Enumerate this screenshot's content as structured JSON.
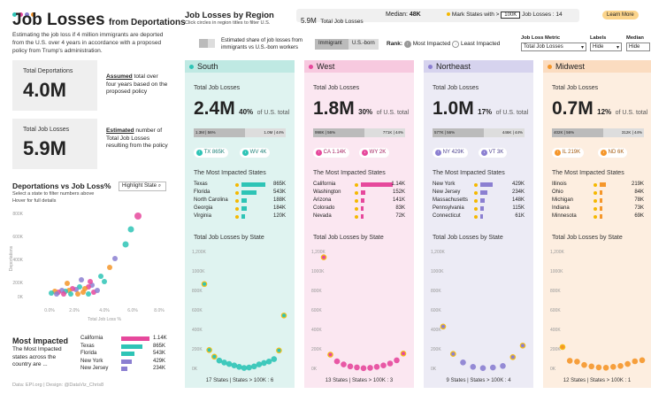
{
  "title": {
    "main": "Job Losses",
    "sub": "from Deportations"
  },
  "intro": "Estimating the job loss if 4 million immigrants are deported from the U.S. over 4 years in accordance with a proposed policy from Trump's administration.",
  "stats": [
    {
      "label": "Total Deportations",
      "value": "4.0M",
      "desc_bold": "Assumed",
      "desc": " total over four years based on the proposed policy"
    },
    {
      "label": "Total Job Losses",
      "value": "5.9M",
      "desc_bold": "Estimated",
      "desc": " number of Total Job Losses resulting from the policy"
    }
  ],
  "scatter": {
    "title": "Deportations vs Job Loss%",
    "button": "Highlight State",
    "note1": "Select a state to filter numbers above",
    "note2": "Hover for full details",
    "ylabel": "Deportations",
    "xlabel": "Total Job Loss %",
    "yticks": [
      "800K",
      "600K",
      "400K",
      "200K",
      "0K"
    ],
    "xticks": [
      "0.0%",
      "2.0%",
      "4.0%",
      "6.0%",
      "8.0%"
    ]
  },
  "most_impacted": {
    "title": "Most Impacted",
    "desc": "The Most Impacted states across the country are ...",
    "rows": [
      {
        "state": "California",
        "value": "1.14K",
        "color": "#e6489c",
        "frac": 1.0
      },
      {
        "state": "Texas",
        "value": "865K",
        "color": "#2ec4b6",
        "frac": 0.76
      },
      {
        "state": "Florida",
        "value": "543K",
        "color": "#2ec4b6",
        "frac": 0.48
      },
      {
        "state": "New York",
        "value": "429K",
        "color": "#8b7fd1",
        "frac": 0.38
      },
      {
        "state": "New Jersey",
        "value": "234K",
        "color": "#8b7fd1",
        "frac": 0.21
      }
    ]
  },
  "credits": "Data: EPI.org | Design: @DataViz_Chris8",
  "header": {
    "title": "Job Losses by Region",
    "subtitle": "Click circles in region titles to filter U.S.",
    "total": "5.9M",
    "total_label": "Total Job Losses",
    "median_label": "Median:",
    "median": "48K",
    "mark_label": "Mark States with >",
    "mark_value": "100K",
    "mark_suffix": "Job Losses :",
    "mark_count": "14",
    "learn": "Learn More"
  },
  "controls": {
    "share_note": "Estimated share of job losses from immigrants vs U.S.-born workers",
    "immigrant": "Immigrant",
    "usborn": "U.S.-born",
    "rank": "Rank:",
    "most": "Most Impacted",
    "least": "Least Impacted",
    "metric_label": "Job Loss Metric",
    "metric_value": "Total Job Losses",
    "labels_label": "Labels",
    "labels_value": "Hide",
    "median_label": "Median",
    "median_value": "Hide"
  },
  "section_labels": {
    "total": "Total Job Losses",
    "states": "The Most Impacted States",
    "by_state": "Total Job Losses by State"
  },
  "yaxis": [
    "1,200K",
    "1000K",
    "800K",
    "600K",
    "400K",
    "200K",
    "0K"
  ],
  "colors": {
    "south": "#2ec4b6",
    "west": "#e6489c",
    "northeast": "#8b7fd1",
    "midwest": "#f5962a",
    "marker": "#f5b800"
  },
  "regions": [
    {
      "name": "South",
      "bg": "#dff3f0",
      "head": "#bfe9e3",
      "accent": "#2ec4b6",
      "ltext": "#1a7f76",
      "total": "2.4M",
      "pct": "40%",
      "pct_label": "of U.S. total",
      "split_left": "1.3M | 56%",
      "split_right": "1.0M | 44%",
      "split_frac": 0.56,
      "top": "TX 865K",
      "bottom": "WV 4K",
      "states": [
        {
          "name": "Texas",
          "value": "865K",
          "frac": 0.76
        },
        {
          "name": "Florida",
          "value": "543K",
          "frac": 0.48
        },
        {
          "name": "North Carolina",
          "value": "188K",
          "frac": 0.16
        },
        {
          "name": "Georgia",
          "value": "184K",
          "frac": 0.16
        },
        {
          "name": "Virginia",
          "value": "120K",
          "frac": 0.1
        }
      ],
      "points": [
        865,
        543,
        188,
        184,
        120,
        95,
        80,
        70,
        60,
        55,
        45,
        40,
        30,
        20,
        15,
        8,
        4
      ],
      "footer": "17 States | States > 100K : 6"
    },
    {
      "name": "West",
      "bg": "#fbe7f1",
      "head": "#f7c9df",
      "accent": "#e6489c",
      "ltext": "#a3205f",
      "total": "1.8M",
      "pct": "30%",
      "pct_label": "of U.S. total",
      "split_left": "998K | 56%",
      "split_right": "771K | 44%",
      "split_frac": 0.56,
      "top": "CA 1.14K",
      "bottom": "WY 2K",
      "states": [
        {
          "name": "California",
          "value": "1.14K",
          "frac": 1.0
        },
        {
          "name": "Washington",
          "value": "152K",
          "frac": 0.13
        },
        {
          "name": "Arizona",
          "value": "141K",
          "frac": 0.12
        },
        {
          "name": "Colorado",
          "value": "83K",
          "frac": 0.07
        },
        {
          "name": "Nevada",
          "value": "72K",
          "frac": 0.06
        }
      ],
      "points": [
        1140,
        152,
        141,
        83,
        72,
        50,
        40,
        30,
        20,
        15,
        10,
        5,
        2
      ],
      "footer": "13 States | States > 100K : 3"
    },
    {
      "name": "Northeast",
      "bg": "#ecebf5",
      "head": "#d6d3ee",
      "accent": "#8b7fd1",
      "ltext": "#4d428f",
      "total": "1.0M",
      "pct": "17%",
      "pct_label": "of U.S. total",
      "split_left": "577K | 56%",
      "split_right": "446K | 44%",
      "split_frac": 0.56,
      "top": "NY 429K",
      "bottom": "VT 3K",
      "states": [
        {
          "name": "New York",
          "value": "429K",
          "frac": 0.38
        },
        {
          "name": "New Jersey",
          "value": "234K",
          "frac": 0.21
        },
        {
          "name": "Massachusetts",
          "value": "148K",
          "frac": 0.13
        },
        {
          "name": "Pennsylvania",
          "value": "115K",
          "frac": 0.1
        },
        {
          "name": "Connecticut",
          "value": "61K",
          "frac": 0.05
        }
      ],
      "points": [
        429,
        234,
        148,
        115,
        61,
        25,
        15,
        8,
        3
      ],
      "footer": "9 States | States > 100K : 4"
    },
    {
      "name": "Midwest",
      "bg": "#fdeee0",
      "head": "#fbdcc0",
      "accent": "#f5962a",
      "ltext": "#a35a10",
      "total": "0.7M",
      "pct": "12%",
      "pct_label": "of U.S. total",
      "split_left": "402K | 56%",
      "split_right": "312K | 44%",
      "split_frac": 0.56,
      "top": "IL 219K",
      "bottom": "ND 6K",
      "states": [
        {
          "name": "Illinois",
          "value": "219K",
          "frac": 0.19
        },
        {
          "name": "Ohio",
          "value": "84K",
          "frac": 0.07
        },
        {
          "name": "Michigan",
          "value": "78K",
          "frac": 0.07
        },
        {
          "name": "Indiana",
          "value": "73K",
          "frac": 0.06
        },
        {
          "name": "Minnesota",
          "value": "69K",
          "frac": 0.06
        }
      ],
      "points": [
        219,
        84,
        78,
        73,
        69,
        45,
        35,
        25,
        20,
        15,
        10,
        6
      ],
      "footer": "12 States | States > 100K : 1"
    }
  ]
}
